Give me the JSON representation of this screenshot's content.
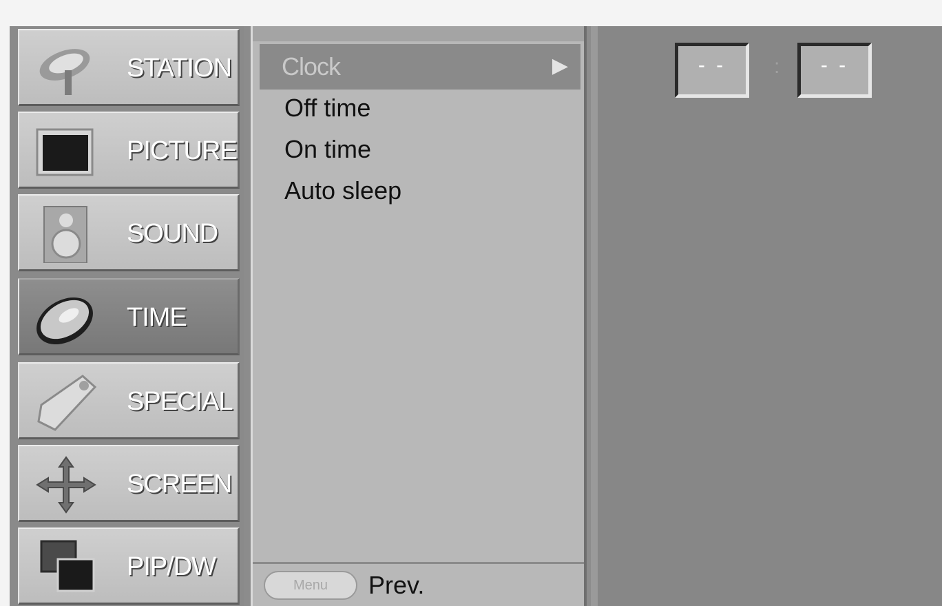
{
  "categories": [
    {
      "label": "STATION",
      "icon": "satellite-dish-icon",
      "active": false
    },
    {
      "label": "PICTURE",
      "icon": "picture-screen-icon",
      "active": false
    },
    {
      "label": "SOUND",
      "icon": "speaker-icon",
      "active": false
    },
    {
      "label": "TIME",
      "icon": "clock-disc-icon",
      "active": true
    },
    {
      "label": "SPECIAL",
      "icon": "tag-icon",
      "active": false
    },
    {
      "label": "SCREEN",
      "icon": "move-arrows-icon",
      "active": false
    },
    {
      "label": "PIP/DW",
      "icon": "pip-windows-icon",
      "active": false
    }
  ],
  "submenu": {
    "selected": "Clock",
    "items": [
      "Off time",
      "On time",
      "Auto sleep"
    ],
    "footer": {
      "key_label": "Menu",
      "prev_label": "Prev."
    }
  },
  "clock": {
    "hour": "- -",
    "minute": "- -",
    "separator": ":"
  }
}
